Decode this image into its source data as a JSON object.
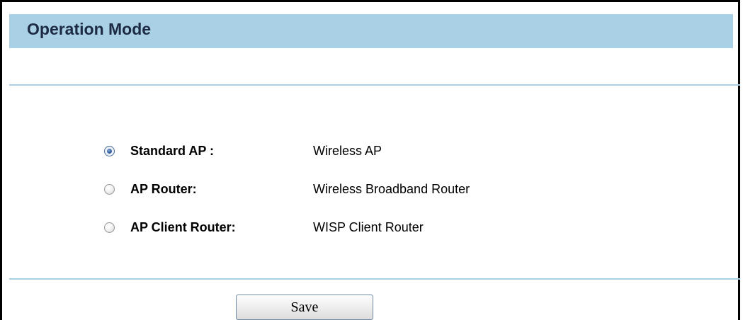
{
  "page": {
    "title": "Operation Mode"
  },
  "modes": [
    {
      "label": "Standard AP :",
      "description": "Wireless AP",
      "selected": true
    },
    {
      "label": "AP Router:",
      "description": "Wireless Broadband Router",
      "selected": false
    },
    {
      "label": "AP Client Router:",
      "description": "WISP Client Router",
      "selected": false
    }
  ],
  "actions": {
    "save_label": "Save"
  },
  "colors": {
    "header_bg": "#a9d0e4",
    "divider": "#a9d0e4",
    "title_text": "#1c2a44"
  }
}
